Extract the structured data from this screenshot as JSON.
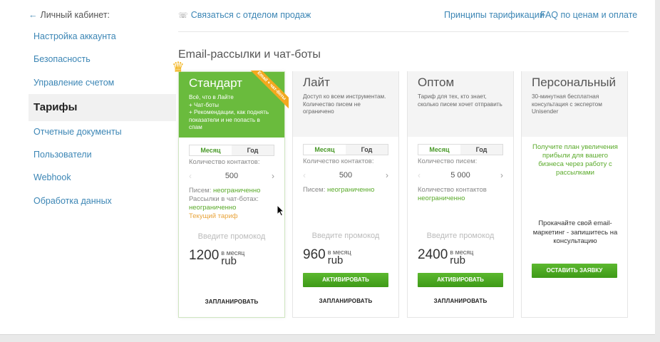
{
  "sidebar": {
    "back": "Личный кабинет:",
    "items": [
      {
        "label": "Настройка аккаунта"
      },
      {
        "label": "Безопасность"
      },
      {
        "label": "Управление счетом"
      },
      {
        "label": "Тарифы",
        "active": true
      },
      {
        "label": "Отчетные документы"
      },
      {
        "label": "Пользователи"
      },
      {
        "label": "Webhook"
      },
      {
        "label": "Обработка данных"
      }
    ]
  },
  "header": {
    "sales_link": "Связаться с отделом продаж",
    "pricing_principles": "Принципы тарификации",
    "faq": "FAQ по ценам и оплате"
  },
  "section_title": "Email-рассылки и чат-боты",
  "plans": {
    "standard": {
      "name": "Стандарт",
      "ribbon": "Email + чат-боты",
      "desc": "Всё, что в Лайте\n+ Чат-боты\n+ Рекомендации, как поднять показатели и не попасть в спам",
      "toggle_month": "Месяц",
      "toggle_year": "Год",
      "field_label": "Количество контактов:",
      "stepper_value": "500",
      "letters_label": "Писем:",
      "letters_value": "неограниченно",
      "bot_label": "Рассылки в чат-ботах:",
      "bot_value": "неограниченно",
      "current": "Текущий тариф",
      "promo": "Введите промокод",
      "price": "1200",
      "per_month": "в месяц",
      "currency": "rub",
      "action": "ЗАПЛАНИРОВАТЬ"
    },
    "lite": {
      "name": "Лайт",
      "desc": "Доступ ко всем инструментам. Количество писем не ограничено",
      "toggle_month": "Месяц",
      "toggle_year": "Год",
      "field_label": "Количество контактов:",
      "stepper_value": "500",
      "letters_label": "Писем:",
      "letters_value": "неограниченно",
      "promo": "Введите промокод",
      "price": "960",
      "per_month": "в месяц",
      "currency": "rub",
      "activate": "АКТИВИРОВАТЬ",
      "action": "ЗАПЛАНИРОВАТЬ"
    },
    "wholesale": {
      "name": "Оптом",
      "desc": "Тариф для тех, кто знает, сколько писем хочет отправить",
      "toggle_month": "Месяц",
      "toggle_year": "Год",
      "field_label": "Количество писем:",
      "stepper_value": "5 000",
      "contacts_label": "Количество контактов",
      "contacts_value": "неограниченно",
      "promo": "Введите промокод",
      "price": "2400",
      "per_month": "в месяц",
      "currency": "rub",
      "activate": "АКТИВИРОВАТЬ",
      "action": "ЗАПЛАНИРОВАТЬ"
    },
    "personal": {
      "name": "Персональный",
      "desc": "30-минутная бесплатная консультация с экспертом Unisender",
      "green_text": "Получите план увеличения прибыли для вашего бизнеса через работу с рассылками",
      "dark_text": "Прокачайте свой email-маркетинг - запишитесь на консультацию",
      "request": "ОСТАВИТЬ ЗАЯВКУ"
    }
  },
  "colors": {
    "accent_green": "#6abb3d",
    "link_blue": "#3c86b5",
    "ribbon_orange": "#f3a81e"
  }
}
